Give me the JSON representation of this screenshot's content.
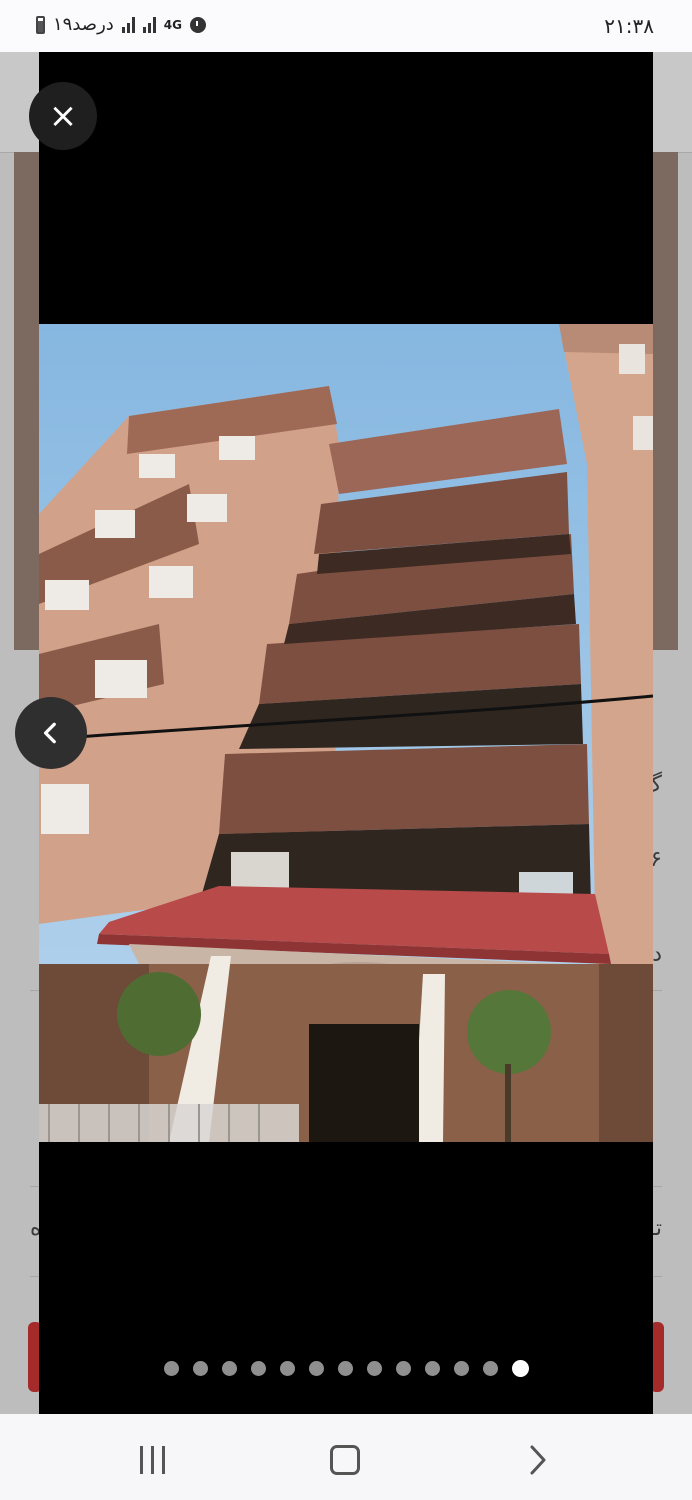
{
  "status_bar": {
    "time": "۲۱:۳۸",
    "battery_label": "۱۹درصد",
    "network": "4G"
  },
  "background_page": {
    "row_texts": [
      "گ",
      "۶",
      "د",
      "تـ"
    ],
    "left_text": "ه"
  },
  "viewer": {
    "close_label": "×",
    "slide_count": 13,
    "active_slide_index": 12,
    "image_alt": "multi-storey residential building facade with balconies and red tiled canopy"
  },
  "colors": {
    "viewer_bg": "#000000",
    "active_dot": "#ffffff",
    "inactive_dot": "#8f8f8f"
  }
}
